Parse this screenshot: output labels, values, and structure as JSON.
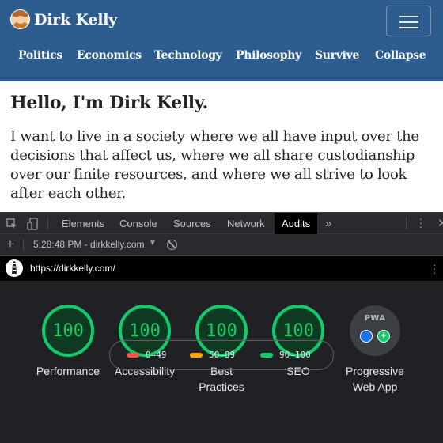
{
  "site": {
    "brand_name": "Dirk Kelly",
    "nav": [
      "Politics",
      "Economics",
      "Technology",
      "Philosophy",
      "Survive",
      "Collapse"
    ]
  },
  "content": {
    "heading": "Hello, I'm Dirk Kelly.",
    "intro": "I want to live in a society where we all have input over the decisions that affect us, where we all share custodianship over our finite resources, and where we all strive to look after each other."
  },
  "devtools": {
    "tabs": [
      "Elements",
      "Console",
      "Sources",
      "Network",
      "Audits"
    ],
    "active_tab": "Audits",
    "more_tabs_icon": "»",
    "report_label": "5:28:48 PM - dirkkelly.com",
    "url": "https://dirkkelly.com/",
    "scores": [
      {
        "label": "Performance",
        "value": "100"
      },
      {
        "label": "Accessibility",
        "value": "100"
      },
      {
        "label": "Best Practices",
        "value": "100"
      },
      {
        "label": "SEO",
        "value": "100"
      }
    ],
    "pwa": {
      "label": "Progressive Web App",
      "badge_text": "PWA"
    },
    "legend": [
      {
        "range": "0–49",
        "color": "#ff4e42"
      },
      {
        "range": "50–89",
        "color": "#ffa400"
      },
      {
        "range": "90–100",
        "color": "#0cce6b"
      }
    ]
  },
  "colors": {
    "header_bg": "#2d5c8f",
    "pass_green": "#0cce6b",
    "devtools_bg": "#202124"
  }
}
